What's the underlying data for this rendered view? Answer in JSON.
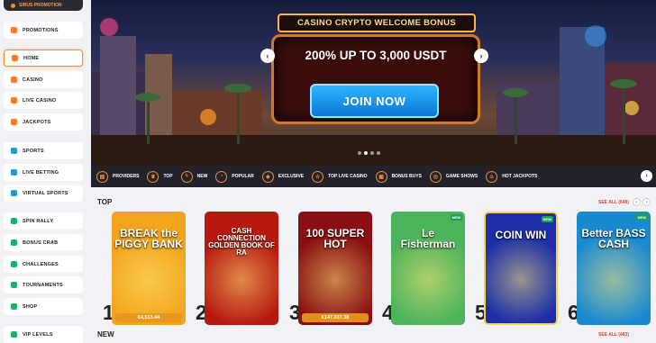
{
  "sidebar": {
    "promo_top": "SIRUS PROMOTION",
    "items": [
      {
        "label": "PROMOTIONS",
        "icon": "gift-icon",
        "color": "orange"
      },
      {
        "label": "HOME",
        "icon": "home-icon",
        "color": "orange",
        "active": true
      },
      {
        "label": "CASINO",
        "icon": "cards-icon",
        "color": "orange"
      },
      {
        "label": "LIVE CASINO",
        "icon": "live-casino-icon",
        "color": "orange"
      },
      {
        "label": "JACKPOTS",
        "icon": "jackpot-icon",
        "color": "orange"
      },
      {
        "label": "SPORTS",
        "icon": "ball-icon",
        "color": "blue"
      },
      {
        "label": "LIVE BETTING",
        "icon": "live-betting-icon",
        "color": "blue"
      },
      {
        "label": "VIRTUAL SPORTS",
        "icon": "virtual-sports-icon",
        "color": "blue"
      },
      {
        "label": "SPIN RALLY",
        "icon": "spin-icon",
        "color": "green"
      },
      {
        "label": "BONUS CRAB",
        "icon": "crab-icon",
        "color": "green"
      },
      {
        "label": "CHALLENGES",
        "icon": "challenge-icon",
        "color": "green"
      },
      {
        "label": "TOURNAMENTS",
        "icon": "trophy-icon",
        "color": "green"
      },
      {
        "label": "SHOP",
        "icon": "shop-icon",
        "color": "green"
      },
      {
        "label": "VIP LEVELS",
        "icon": "vip-icon",
        "color": "green"
      }
    ]
  },
  "banner": {
    "badge": "CASINO CRYPTO WELCOME BONUS",
    "offer": "200% UP TO 3,000 USDT",
    "cta": "JOIN NOW",
    "prev": "‹",
    "next": "›"
  },
  "categories": {
    "items": [
      {
        "label": "PROVIDERS",
        "glyph": "▤"
      },
      {
        "label": "TOP",
        "glyph": "♛"
      },
      {
        "label": "NEW",
        "glyph": "ϟ"
      },
      {
        "label": "POPULAR",
        "glyph": "◔"
      },
      {
        "label": "EXCLUSIVE",
        "glyph": "◆"
      },
      {
        "label": "TOP LIVE CASINO",
        "glyph": "☆"
      },
      {
        "label": "BONUS BUYS",
        "glyph": "▣"
      },
      {
        "label": "GAME SHOWS",
        "glyph": "◎"
      },
      {
        "label": "HOT JACKPOTS",
        "glyph": "♨"
      }
    ],
    "next": "›"
  },
  "top_section": {
    "title": "TOP",
    "see_all": "SEE ALL (648)",
    "games": [
      {
        "rank": "1",
        "title": "BREAK the PIGGY BANK",
        "jackpot": "€4,513.44",
        "new": false,
        "bg": "#f2a51a"
      },
      {
        "rank": "2",
        "title": "CASH CONNECTION GOLDEN BOOK OF RA",
        "jackpot": "",
        "new": false,
        "bg": "#b8190f"
      },
      {
        "rank": "3",
        "title": "100 SUPER HOT",
        "jackpot": "€147,037.38",
        "new": false,
        "bg": "#8a0f12"
      },
      {
        "rank": "4",
        "title": "Le Fisherman",
        "jackpot": "",
        "new": true,
        "bg": "#4bb35a"
      },
      {
        "rank": "5",
        "title": "COIN WIN",
        "jackpot": "",
        "new": true,
        "bg": "#1c2fa8"
      },
      {
        "rank": "6",
        "title": "Better BASS CASH",
        "jackpot": "",
        "new": true,
        "bg": "#1a8ad0"
      }
    ]
  },
  "new_section": {
    "title": "NEW",
    "see_all": "SEE ALL (483)"
  },
  "colors": {
    "accent": "#ff8a2a",
    "dark_bar": "#22232a",
    "link": "#e8442a"
  }
}
